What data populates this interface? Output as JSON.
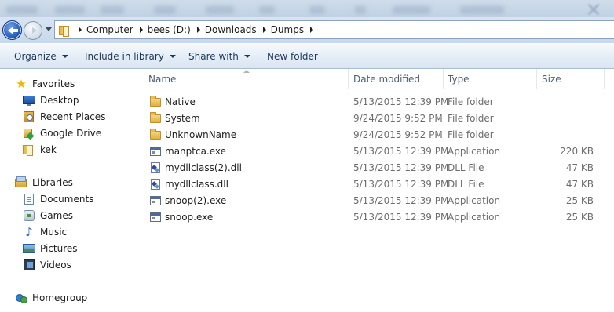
{
  "address_bar": {
    "breadcrumbs": [
      "Computer",
      "bees (D:)",
      "Downloads",
      "Dumps"
    ]
  },
  "toolbar": {
    "organize_label": "Organize",
    "include_label": "Include in library",
    "share_label": "Share with",
    "new_folder_label": "New folder"
  },
  "nav": {
    "favorites_label": "Favorites",
    "favorites": [
      "Desktop",
      "Recent Places",
      "Google Drive",
      "kek"
    ],
    "libraries_label": "Libraries",
    "libraries": [
      "Documents",
      "Games",
      "Music",
      "Pictures",
      "Videos"
    ],
    "homegroup_label": "Homegroup"
  },
  "columns": {
    "name": "Name",
    "date": "Date modified",
    "type": "Type",
    "size": "Size"
  },
  "files": [
    {
      "name": "Native",
      "date": "5/13/2015 12:39 PM",
      "type": "File folder",
      "size": "",
      "icon": "folder-icon"
    },
    {
      "name": "System",
      "date": "9/24/2015 9:52 PM",
      "type": "File folder",
      "size": "",
      "icon": "folder-icon"
    },
    {
      "name": "UnknownName",
      "date": "9/24/2015 9:52 PM",
      "type": "File folder",
      "size": "",
      "icon": "folder-icon"
    },
    {
      "name": "manptca.exe",
      "date": "5/13/2015 12:39 PM",
      "type": "Application",
      "size": "220 KB",
      "icon": "exe-icon"
    },
    {
      "name": "mydllclass(2).dll",
      "date": "5/13/2015 12:39 PM",
      "type": "DLL File",
      "size": "47 KB",
      "icon": "dll-icon"
    },
    {
      "name": "mydllclass.dll",
      "date": "5/13/2015 12:39 PM",
      "type": "DLL File",
      "size": "47 KB",
      "icon": "dll-icon"
    },
    {
      "name": "snoop(2).exe",
      "date": "5/13/2015 12:39 PM",
      "type": "Application",
      "size": "25 KB",
      "icon": "exe-icon"
    },
    {
      "name": "snoop.exe",
      "date": "5/13/2015 12:39 PM",
      "type": "Application",
      "size": "25 KB",
      "icon": "exe-icon"
    }
  ],
  "colors": {
    "toolbar_text": "#1e395b",
    "header_text": "#4c607a",
    "secondary_text": "#6d6d6d",
    "folder_yellow": "#e2b13c",
    "nav_blue": "#1d55b7"
  }
}
